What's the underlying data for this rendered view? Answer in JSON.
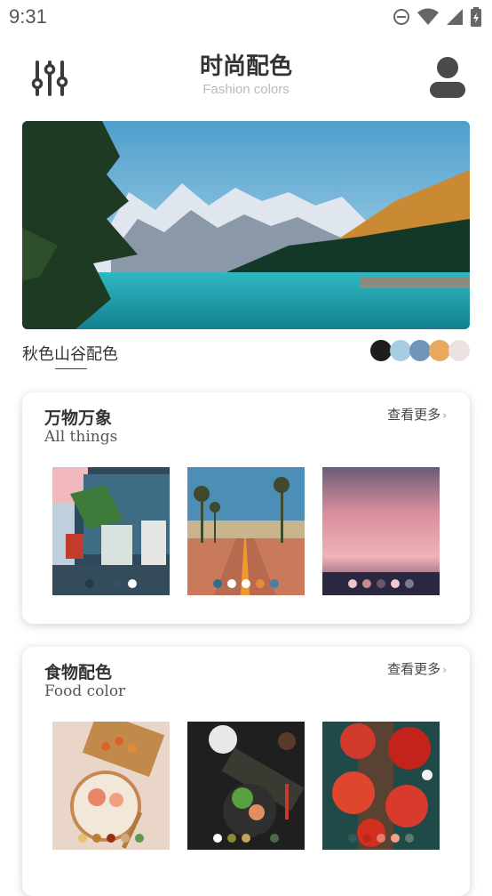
{
  "status": {
    "time": "9:31"
  },
  "header": {
    "title": "时尚配色",
    "subtitle": "Fashion colors"
  },
  "hero": {
    "caption": "秋色山谷配色",
    "palette": [
      "#1e1e1e",
      "#a6cce3",
      "#6f95b8",
      "#e9a860",
      "#ede2e0"
    ]
  },
  "sections": [
    {
      "title": "万物万象",
      "subtitle": "All things",
      "more": "查看更多",
      "items": [
        {
          "name": "street-shop",
          "palette": [
            "#233c4a",
            "#2b4e5b",
            "#34506a",
            "#ffffff"
          ]
        },
        {
          "name": "palm-road",
          "palette": [
            "#2e6f8f",
            "#ffffff",
            "#ffffff",
            "#e88a3c",
            "#4a7fa5"
          ]
        },
        {
          "name": "pink-sunset",
          "palette": [
            "#f0c5c7",
            "#c98a8e",
            "#6a5569",
            "#f5c7d0",
            "#7b7a95"
          ]
        }
      ]
    },
    {
      "title": "食物配色",
      "subtitle": "Food color",
      "more": "查看更多",
      "items": [
        {
          "name": "noodle-bowl",
          "palette": [
            "#e8c26b",
            "#b77f2f",
            "#9c2b14",
            "#ccaa80",
            "#5e9a4a"
          ]
        },
        {
          "name": "dark-dinner",
          "palette": [
            "#ffffff",
            "#8c8a2e",
            "#c4a65a",
            "#1f1f1f",
            "#4c6b4a"
          ]
        },
        {
          "name": "strawberry-tarts",
          "palette": [
            "#2f5d55",
            "#c0281c",
            "#e87a6a",
            "#f0a28a",
            "#5b7d70"
          ]
        }
      ]
    }
  ]
}
